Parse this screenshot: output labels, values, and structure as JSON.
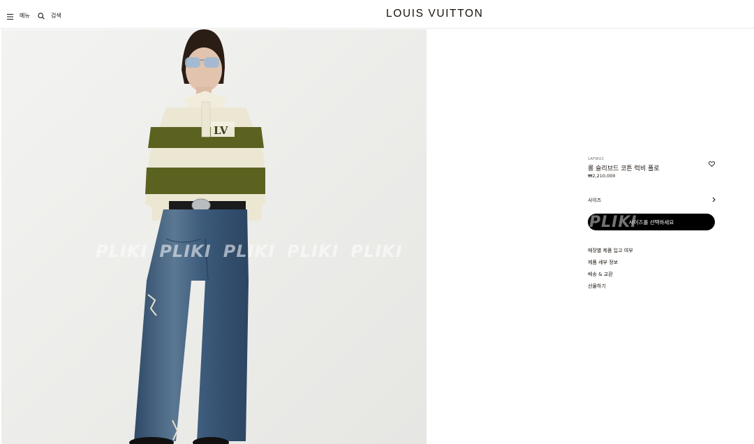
{
  "header": {
    "menu_label": "메뉴",
    "search_label": "검색",
    "logo": "LOUIS VUITTON"
  },
  "image": {
    "watermarks": [
      "PLIKI",
      "PLIKI",
      "PLIKI",
      "PLIKI",
      "PLIKI"
    ],
    "colors": {
      "background": "#efefed",
      "stripe_green": "#5b6220",
      "stripe_cream": "#ece7d2",
      "denim": "#3b5878"
    }
  },
  "product": {
    "sku": "1AFWUC",
    "name": "롱 슬리브드 코튼 럭비 폴로",
    "price": "₩2,210,000",
    "size_label": "사이즈",
    "cta_watermark": "PLIKI",
    "cta_label": "사이즈를 선택하세요",
    "links": [
      "매장별 제품 입고 여부",
      "제품 세부 정보",
      "배송 & 교환",
      "선물하기"
    ]
  },
  "icons": {
    "menu": "hamburger-icon",
    "search": "search-icon",
    "wishlist": "heart-icon",
    "size_chevron": "chevron-right-icon"
  }
}
